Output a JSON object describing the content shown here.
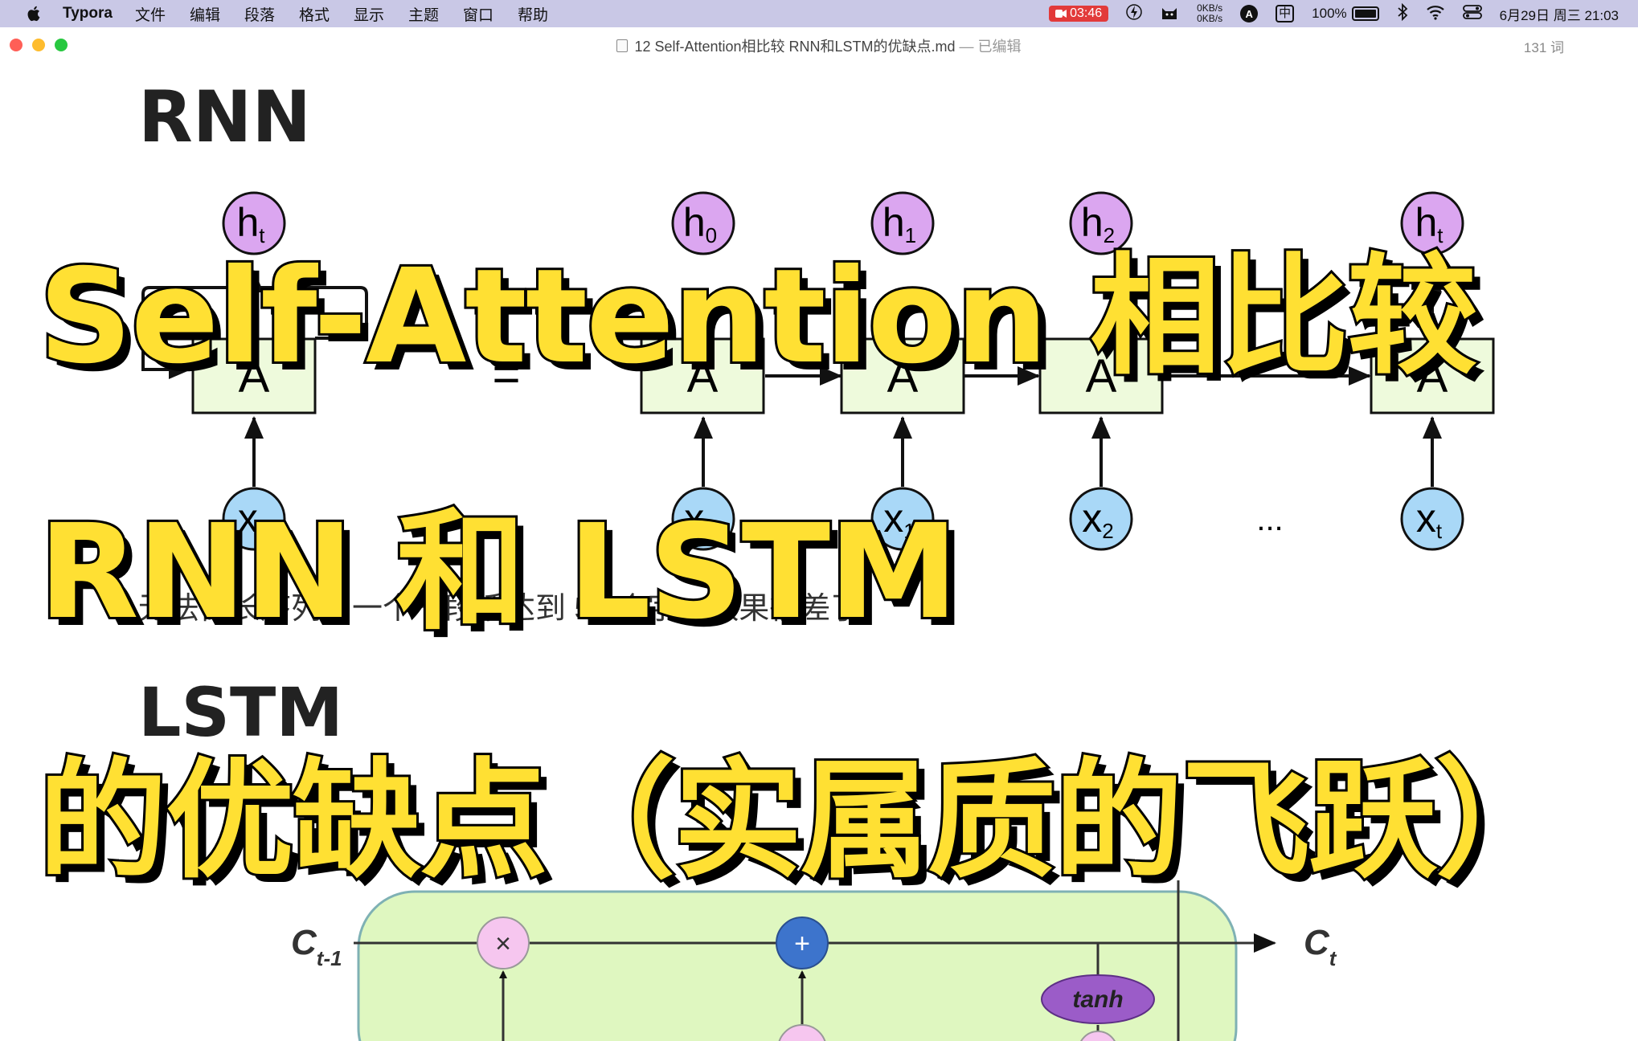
{
  "menubar": {
    "app_name": "Typora",
    "menus": [
      "文件",
      "编辑",
      "段落",
      "格式",
      "显示",
      "主题",
      "窗口",
      "帮助"
    ],
    "recording_time": "03:46",
    "net_up": "0KB/s",
    "net_down": "0KB/s",
    "input_badge": "A",
    "input_method": "中",
    "battery": "100%",
    "datetime": "6月29日 周三 21:03"
  },
  "window": {
    "title": "12 Self-Attention相比较 RNN和LSTM的优缺点.md",
    "edited_status": "— 已编辑",
    "word_count": "131 词"
  },
  "document": {
    "heading_rnn": "RNN",
    "paragraph": "无法做长序列，一个一段话达到 50 个字，效果很差了",
    "heading_lstm": "LSTM"
  },
  "rnn_diagram": {
    "cell_label": "A",
    "equals": "=",
    "ellipsis": "...",
    "outputs": [
      "h",
      "h",
      "h",
      "h",
      "h"
    ],
    "output_subs": [
      "t",
      "0",
      "1",
      "2",
      "t"
    ],
    "inputs": [
      "x",
      "x",
      "x",
      "x",
      "x"
    ],
    "input_subs": [
      "t",
      "0",
      "1",
      "2",
      "t"
    ]
  },
  "lstm_diagram": {
    "c_prev": "C",
    "c_prev_sub": "t-1",
    "c_next": "C",
    "c_next_sub": "t",
    "mult_op": "×",
    "add_op": "+",
    "tanh": "tanh"
  },
  "overlay": {
    "line1": "Self-Attention 相比较",
    "line2": "RNN 和 LSTM",
    "line3": "的优缺点（实属质的飞跃）"
  },
  "colors": {
    "menubar_bg": "#c9c8e6",
    "overlay_fill": "#ffe033",
    "cell_fill": "#eefadc",
    "h_node": "#dba6f0",
    "x_node": "#a9d8f7",
    "lstm_bg": "#dff7c0",
    "add_node": "#3d74cc",
    "tanh_node": "#9b5cc8"
  }
}
